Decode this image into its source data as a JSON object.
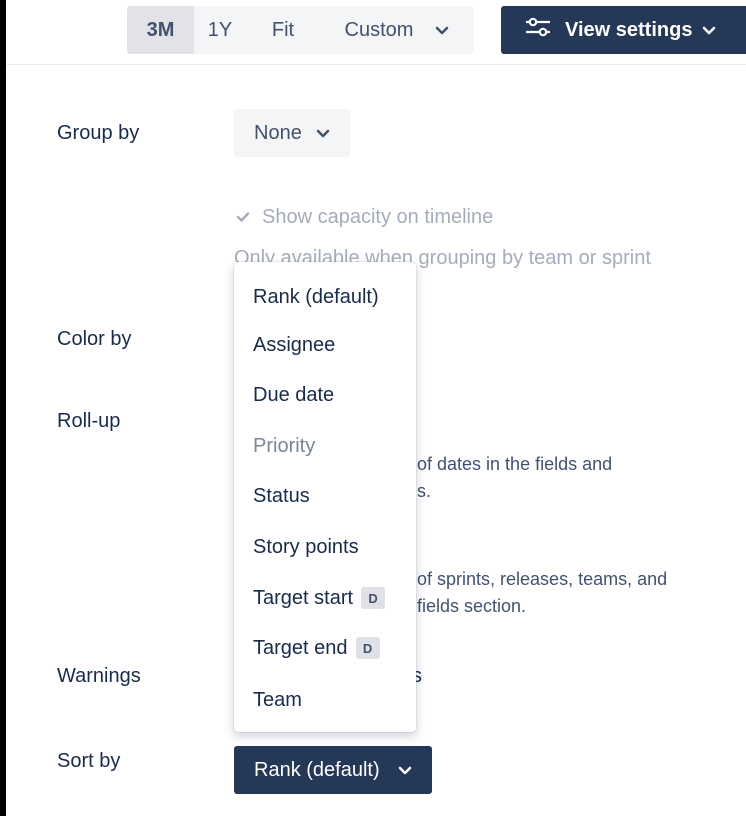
{
  "toolbar": {
    "range_3m": "3M",
    "range_1y": "1Y",
    "range_fit": "Fit",
    "range_custom": "Custom",
    "view_settings": "View settings"
  },
  "form": {
    "group_by_label": "Group by",
    "group_by_value": "None",
    "show_capacity_label": "Show capacity on timeline",
    "show_capacity_checked": true,
    "show_capacity_helper": "Only available when grouping by team or sprint",
    "color_by_label": "Color by",
    "rollup_label": "Roll-up",
    "rollup_desc_line1": "of dates in the fields and",
    "rollup_desc_line2": "s.",
    "rollup_desc2_line1": "of sprints, releases, teams, and",
    "rollup_desc2_line2": "fields section.",
    "warnings_label": "Warnings",
    "warnings_desc": "s",
    "sort_by_label": "Sort by",
    "sort_by_value": "Rank (default)"
  },
  "menu": {
    "items": [
      {
        "label": "Rank (default)",
        "disabled": false
      },
      {
        "label": "Assignee",
        "disabled": false
      },
      {
        "label": "Due date",
        "disabled": false
      },
      {
        "label": "Priority",
        "disabled": true
      },
      {
        "label": "Status",
        "disabled": false
      },
      {
        "label": "Story points",
        "disabled": false
      },
      {
        "label": "Target start",
        "disabled": false,
        "badge": "D"
      },
      {
        "label": "Target end",
        "disabled": false,
        "badge": "D"
      },
      {
        "label": "Team",
        "disabled": false
      }
    ]
  },
  "colors": {
    "accent_dark": "#253858",
    "text": "#172b4d",
    "muted": "#a5adba"
  }
}
